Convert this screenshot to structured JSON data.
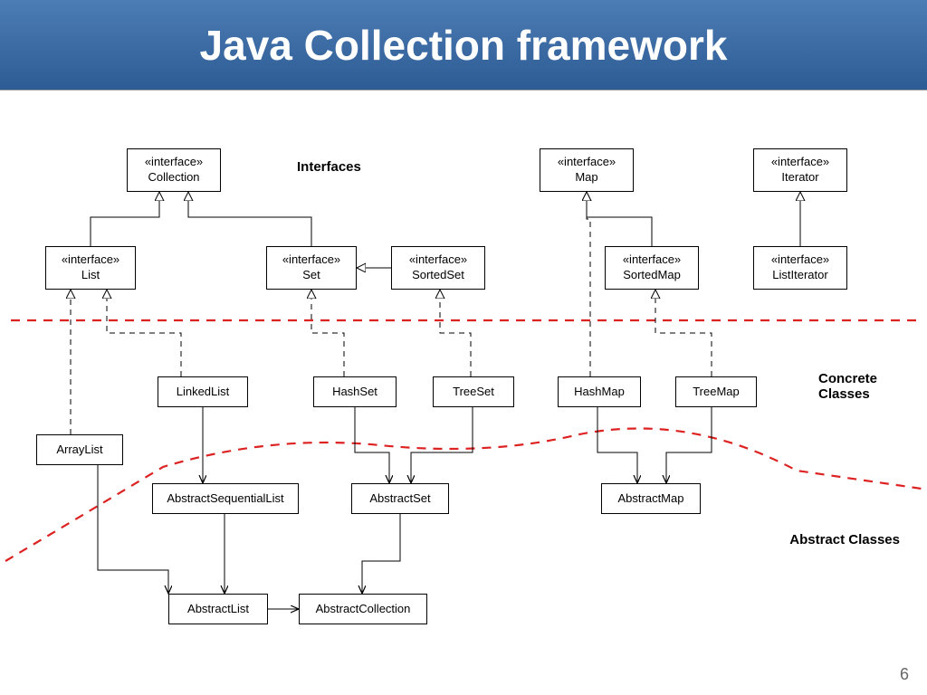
{
  "header": {
    "title": "Java Collection framework"
  },
  "labels": {
    "interfaces": "Interfaces",
    "concrete": "Concrete Classes",
    "abstract": "Abstract Classes"
  },
  "nodes": {
    "collection": {
      "stereo": "«interface»",
      "name": "Collection"
    },
    "map": {
      "stereo": "«interface»",
      "name": "Map"
    },
    "iterator": {
      "stereo": "«interface»",
      "name": "Iterator"
    },
    "list": {
      "stereo": "«interface»",
      "name": "List"
    },
    "set": {
      "stereo": "«interface»",
      "name": "Set"
    },
    "sortedset": {
      "stereo": "«interface»",
      "name": "SortedSet"
    },
    "sortedmap": {
      "stereo": "«interface»",
      "name": "SortedMap"
    },
    "listiterator": {
      "stereo": "«interface»",
      "name": "ListIterator"
    },
    "arraylist": {
      "name": "ArrayList"
    },
    "linkedlist": {
      "name": "LinkedList"
    },
    "hashset": {
      "name": "HashSet"
    },
    "treeset": {
      "name": "TreeSet"
    },
    "hashmap": {
      "name": "HashMap"
    },
    "treemap": {
      "name": "TreeMap"
    },
    "abstractsequentiallist": {
      "name": "AbstractSequentialList"
    },
    "abstractset": {
      "name": "AbstractSet"
    },
    "abstractmap": {
      "name": "AbstractMap"
    },
    "abstractlist": {
      "name": "AbstractList"
    },
    "abstractcollection": {
      "name": "AbstractCollection"
    }
  },
  "page_number": "6",
  "chart_data": {
    "type": "diagram",
    "title": "Java Collection framework",
    "description": "UML-style class hierarchy showing Java Collection Framework interfaces, concrete classes, and abstract classes with inheritance/implementation relations",
    "regions": [
      "Interfaces",
      "Concrete Classes",
      "Abstract Classes"
    ],
    "nodes": [
      {
        "id": "Collection",
        "kind": "interface",
        "region": "Interfaces"
      },
      {
        "id": "Map",
        "kind": "interface",
        "region": "Interfaces"
      },
      {
        "id": "Iterator",
        "kind": "interface",
        "region": "Interfaces"
      },
      {
        "id": "List",
        "kind": "interface",
        "region": "Interfaces"
      },
      {
        "id": "Set",
        "kind": "interface",
        "region": "Interfaces"
      },
      {
        "id": "SortedSet",
        "kind": "interface",
        "region": "Interfaces"
      },
      {
        "id": "SortedMap",
        "kind": "interface",
        "region": "Interfaces"
      },
      {
        "id": "ListIterator",
        "kind": "interface",
        "region": "Interfaces"
      },
      {
        "id": "ArrayList",
        "kind": "concrete",
        "region": "Concrete Classes"
      },
      {
        "id": "LinkedList",
        "kind": "concrete",
        "region": "Concrete Classes"
      },
      {
        "id": "HashSet",
        "kind": "concrete",
        "region": "Concrete Classes"
      },
      {
        "id": "TreeSet",
        "kind": "concrete",
        "region": "Concrete Classes"
      },
      {
        "id": "HashMap",
        "kind": "concrete",
        "region": "Concrete Classes"
      },
      {
        "id": "TreeMap",
        "kind": "concrete",
        "region": "Concrete Classes"
      },
      {
        "id": "AbstractSequentialList",
        "kind": "abstract",
        "region": "Abstract Classes"
      },
      {
        "id": "AbstractSet",
        "kind": "abstract",
        "region": "Abstract Classes"
      },
      {
        "id": "AbstractMap",
        "kind": "abstract",
        "region": "Abstract Classes"
      },
      {
        "id": "AbstractList",
        "kind": "abstract",
        "region": "Abstract Classes"
      },
      {
        "id": "AbstractCollection",
        "kind": "abstract",
        "region": "Abstract Classes"
      }
    ],
    "edges": [
      {
        "from": "List",
        "to": "Collection",
        "type": "extends"
      },
      {
        "from": "Set",
        "to": "Collection",
        "type": "extends"
      },
      {
        "from": "SortedSet",
        "to": "Set",
        "type": "extends"
      },
      {
        "from": "SortedMap",
        "to": "Map",
        "type": "extends"
      },
      {
        "from": "ListIterator",
        "to": "Iterator",
        "type": "extends"
      },
      {
        "from": "ArrayList",
        "to": "List",
        "type": "implements"
      },
      {
        "from": "LinkedList",
        "to": "List",
        "type": "implements"
      },
      {
        "from": "HashSet",
        "to": "Set",
        "type": "implements"
      },
      {
        "from": "TreeSet",
        "to": "SortedSet",
        "type": "implements"
      },
      {
        "from": "HashMap",
        "to": "Map",
        "type": "implements"
      },
      {
        "from": "TreeMap",
        "to": "SortedMap",
        "type": "implements"
      },
      {
        "from": "ArrayList",
        "to": "AbstractList",
        "type": "extends"
      },
      {
        "from": "LinkedList",
        "to": "AbstractSequentialList",
        "type": "extends"
      },
      {
        "from": "HashSet",
        "to": "AbstractSet",
        "type": "extends"
      },
      {
        "from": "TreeSet",
        "to": "AbstractSet",
        "type": "extends"
      },
      {
        "from": "HashMap",
        "to": "AbstractMap",
        "type": "extends"
      },
      {
        "from": "TreeMap",
        "to": "AbstractMap",
        "type": "extends"
      },
      {
        "from": "AbstractSequentialList",
        "to": "AbstractList",
        "type": "extends"
      },
      {
        "from": "AbstractSet",
        "to": "AbstractCollection",
        "type": "extends"
      },
      {
        "from": "AbstractList",
        "to": "AbstractCollection",
        "type": "extends"
      },
      {
        "from": "AbstractCollection",
        "to": "Collection",
        "type": "implements"
      }
    ]
  }
}
